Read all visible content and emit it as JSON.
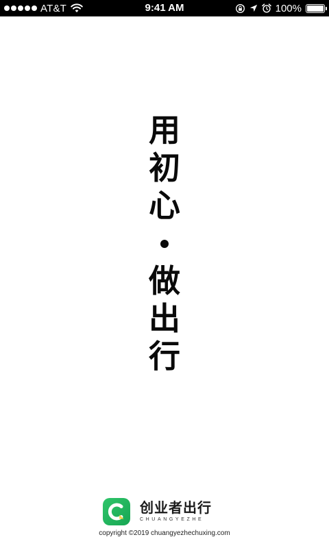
{
  "status_bar": {
    "carrier": "AT&T",
    "time": "9:41 AM",
    "battery_percent": "100%",
    "signal_bars": 5,
    "icons": [
      "signal-dots-icon",
      "wifi-icon",
      "orientation-lock-icon",
      "location-arrow-icon",
      "alarm-icon",
      "battery-icon"
    ]
  },
  "slogan": {
    "chars": [
      "用",
      "初",
      "心",
      "做",
      "出",
      "行"
    ]
  },
  "brand": {
    "name": "创业者出行",
    "subtitle": "CHUANGYEZHE",
    "logo_icon": "brand-c-logo-icon",
    "colors": {
      "logo_green": "#1fb45c",
      "logo_accent": "#f5d04a"
    }
  },
  "footer": {
    "copyright": "copyright ©2019 chuangyezhechuxing.com"
  }
}
